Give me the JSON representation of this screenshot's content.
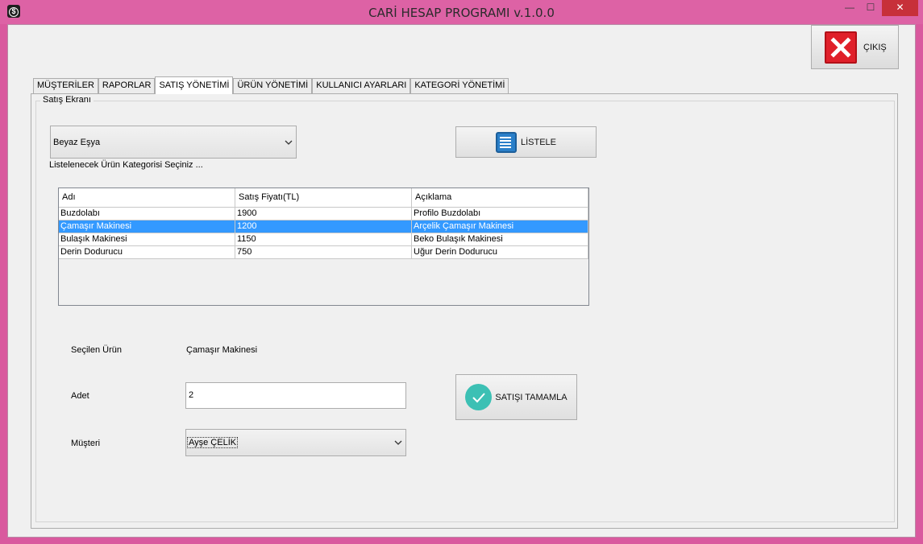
{
  "window": {
    "title": "CARİ HESAP PROGRAMI v.1.0.0",
    "controls": {
      "minimize": "—",
      "maximize": "☐",
      "close": "✕"
    }
  },
  "header": {
    "exit_label": "ÇIKIŞ"
  },
  "tabs": [
    {
      "label": "MÜŞTERİLER",
      "active": false
    },
    {
      "label": "RAPORLAR",
      "active": false
    },
    {
      "label": "SATIŞ YÖNETİMİ",
      "active": true
    },
    {
      "label": "ÜRÜN YÖNETİMİ",
      "active": false
    },
    {
      "label": "KULLANICI AYARLARI",
      "active": false
    },
    {
      "label": "KATEGORİ YÖNETİMİ",
      "active": false
    }
  ],
  "sales": {
    "group_title": "Satış Ekranı",
    "category_value": "Beyaz Eşya",
    "category_hint": "Listelenecek Ürün Kategorisi Seçiniz ...",
    "list_button": "LİSTELE",
    "table": {
      "headers": [
        "Adı",
        "Satış Fiyatı(TL)",
        "Açıklama"
      ],
      "rows": [
        [
          "Buzdolabı",
          "1900",
          "Profilo Buzdolabı"
        ],
        [
          "Çamaşır Makinesi",
          "1200",
          "Arçelik Çamaşır Makinesi"
        ],
        [
          "Bulaşık Makinesi",
          "1150",
          "Beko Bulaşık Makinesi"
        ],
        [
          "Derin Dodurucu",
          "750",
          "Uğur Derin Dodurucu"
        ]
      ],
      "selected_row": 1
    },
    "selected_product_label": "Seçilen Ürün",
    "selected_product_value": "Çamaşır Makinesi",
    "quantity_label": "Adet",
    "quantity_value": "2",
    "customer_label": "Müşteri",
    "customer_value": "Ayşe ÇELİK",
    "complete_button": "SATIŞI TAMAMLA"
  },
  "colors": {
    "window_frame": "#d9599e",
    "selection": "#3399ff",
    "exit_red": "#e0202a",
    "list_blue": "#2a7fc9",
    "check_teal": "#3cc0b4"
  },
  "icons": [
    "app-icon",
    "close-icon",
    "list-icon",
    "chevron-down-icon",
    "checkmark-icon"
  ]
}
